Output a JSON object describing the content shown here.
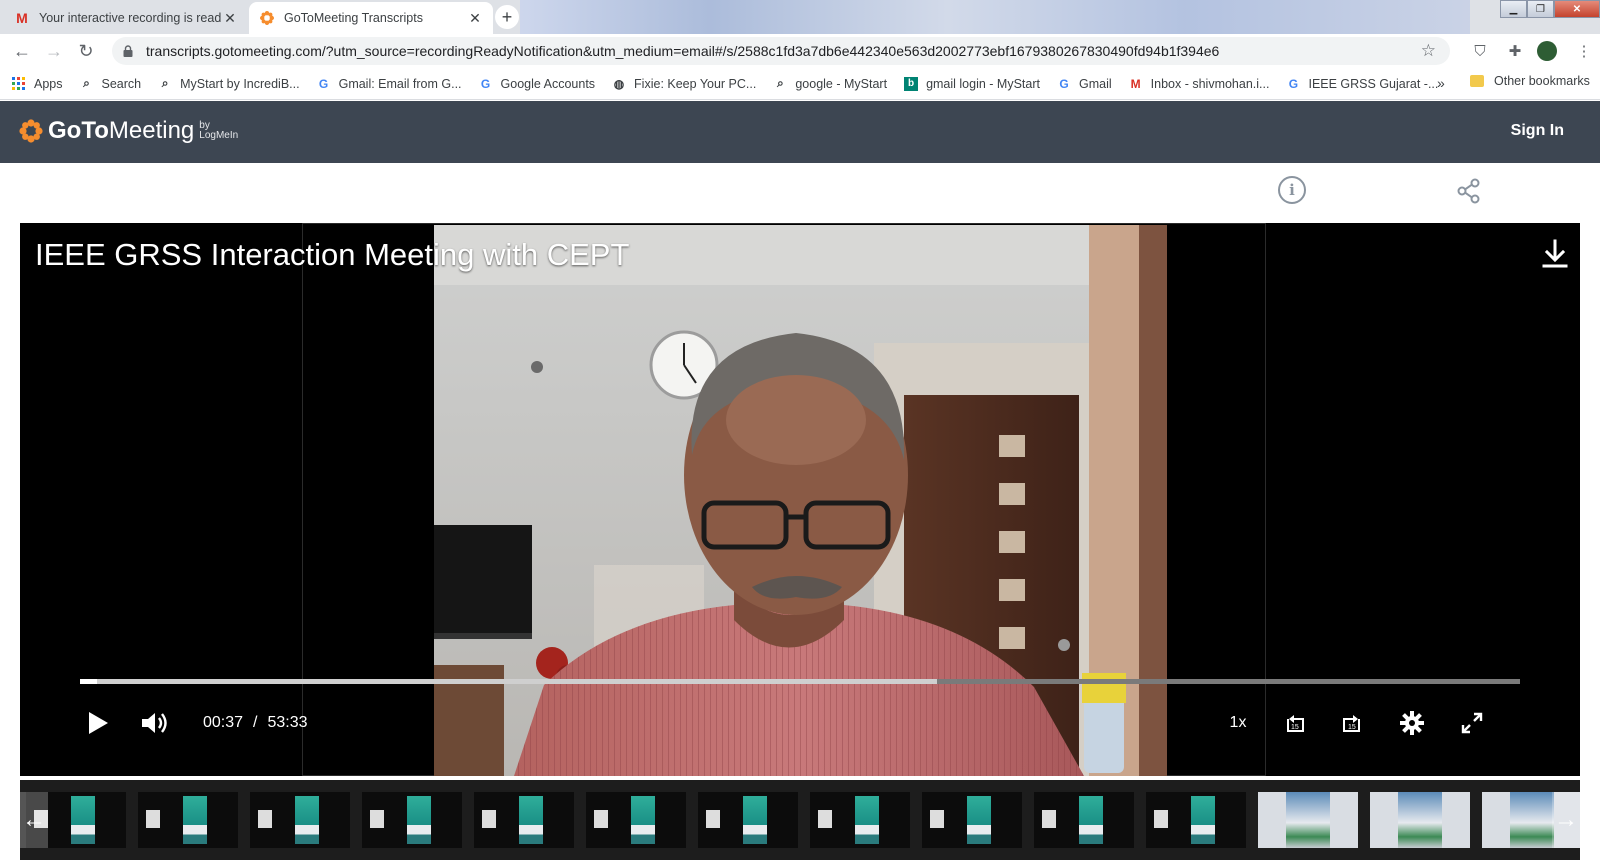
{
  "browser": {
    "tabs": [
      {
        "title": "Your interactive recording is read",
        "favicon": "gmail-icon",
        "active": false
      },
      {
        "title": "GoToMeeting Transcripts",
        "favicon": "gotomeeting-icon",
        "active": true
      }
    ],
    "new_tab": "+",
    "url": "transcripts.gotomeeting.com/?utm_source=recordingReadyNotification&utm_medium=email#/s/2588c1fd3a7db6e442340e563d2002773ebf1679380267830490fd94b1f394e6",
    "bookmarks": [
      {
        "label": "Apps",
        "icon": "apps-grid-icon"
      },
      {
        "label": "Search",
        "icon": "search-icon"
      },
      {
        "label": "MyStart by IncrediB...",
        "icon": "search-icon"
      },
      {
        "label": "Gmail: Email from G...",
        "icon": "google-icon"
      },
      {
        "label": "Google Accounts",
        "icon": "google-icon"
      },
      {
        "label": "Fixie: Keep Your PC...",
        "icon": "globe-icon"
      },
      {
        "label": "google - MyStart",
        "icon": "search-icon"
      },
      {
        "label": "gmail login - MyStart",
        "icon": "bing-icon"
      },
      {
        "label": "Gmail",
        "icon": "google-icon"
      },
      {
        "label": "Inbox - shivmohan.i...",
        "icon": "gmail-icon"
      },
      {
        "label": "IEEE GRSS Gujarat -...",
        "icon": "google-icon"
      }
    ],
    "bookmarks_more": "»",
    "other_bookmarks": "Other bookmarks"
  },
  "header": {
    "logo_goto": "GoTo",
    "logo_meeting": "Meeting",
    "logo_by_line1": "by",
    "logo_by_line2": "LogMeIn",
    "sign_in": "Sign In"
  },
  "icons_row": {
    "info": "i"
  },
  "player": {
    "title": "IEEE GRSS Interaction Meeting with CEPT",
    "current_time": "00:37",
    "separator": "/",
    "duration": "53:33",
    "speed": "1x",
    "rewind_label": "15",
    "forward_label": "15",
    "played_fraction": 0.0115,
    "buffered_fraction": 0.595
  },
  "filmstrip": {
    "thumbnails": [
      "screen",
      "screen",
      "screen",
      "screen",
      "screen",
      "screen",
      "screen",
      "screen",
      "screen",
      "screen",
      "screen",
      "photo",
      "photo",
      "photo"
    ],
    "prev": "←",
    "next": "→"
  },
  "colors": {
    "header_bg": "#3d4652",
    "accent_orange": "#f68d2e",
    "player_bg": "#000000"
  }
}
